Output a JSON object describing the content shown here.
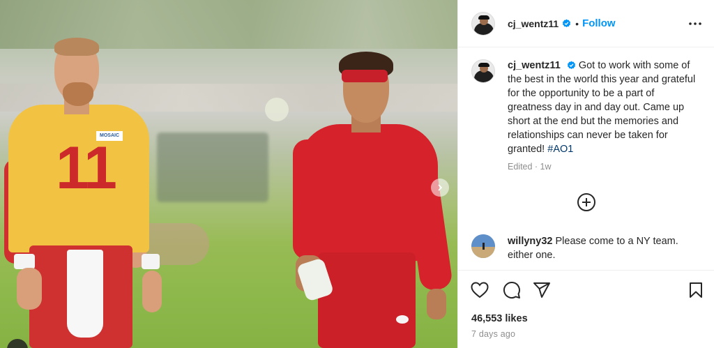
{
  "post": {
    "author": "cj_wentz11",
    "verified": true,
    "header_separator": "•",
    "follow_label": "Follow",
    "more_label": "More options",
    "caption": "Got to work with some of the best in the world this year and grateful for the opportunity to be a part of greatness day in and day out. Came up short at the end but the memories and relationships can never be taken for granted!",
    "hashtag": "#AO1",
    "caption_meta": "Edited · 1w",
    "photo": {
      "left_player_number": "11",
      "left_player_patch": "MOSAIC"
    }
  },
  "comments": [
    {
      "user": "willyny32",
      "text": "Please come to a NY team. either one."
    }
  ],
  "actions": {
    "likes": "46,553 likes",
    "date": "7 days ago"
  },
  "icons": {
    "verified": "verified-badge-icon",
    "more": "more-dots-icon",
    "load_more": "plus-circle-icon",
    "like": "heart-icon",
    "comment": "comment-bubble-icon",
    "share": "paper-plane-icon",
    "save": "bookmark-icon",
    "next": "chevron-right-icon"
  },
  "colors": {
    "accent": "#0095f6",
    "verified": "#0095f6",
    "hashtag": "#00376b",
    "muted": "#8e8e8e",
    "text": "#262626"
  }
}
